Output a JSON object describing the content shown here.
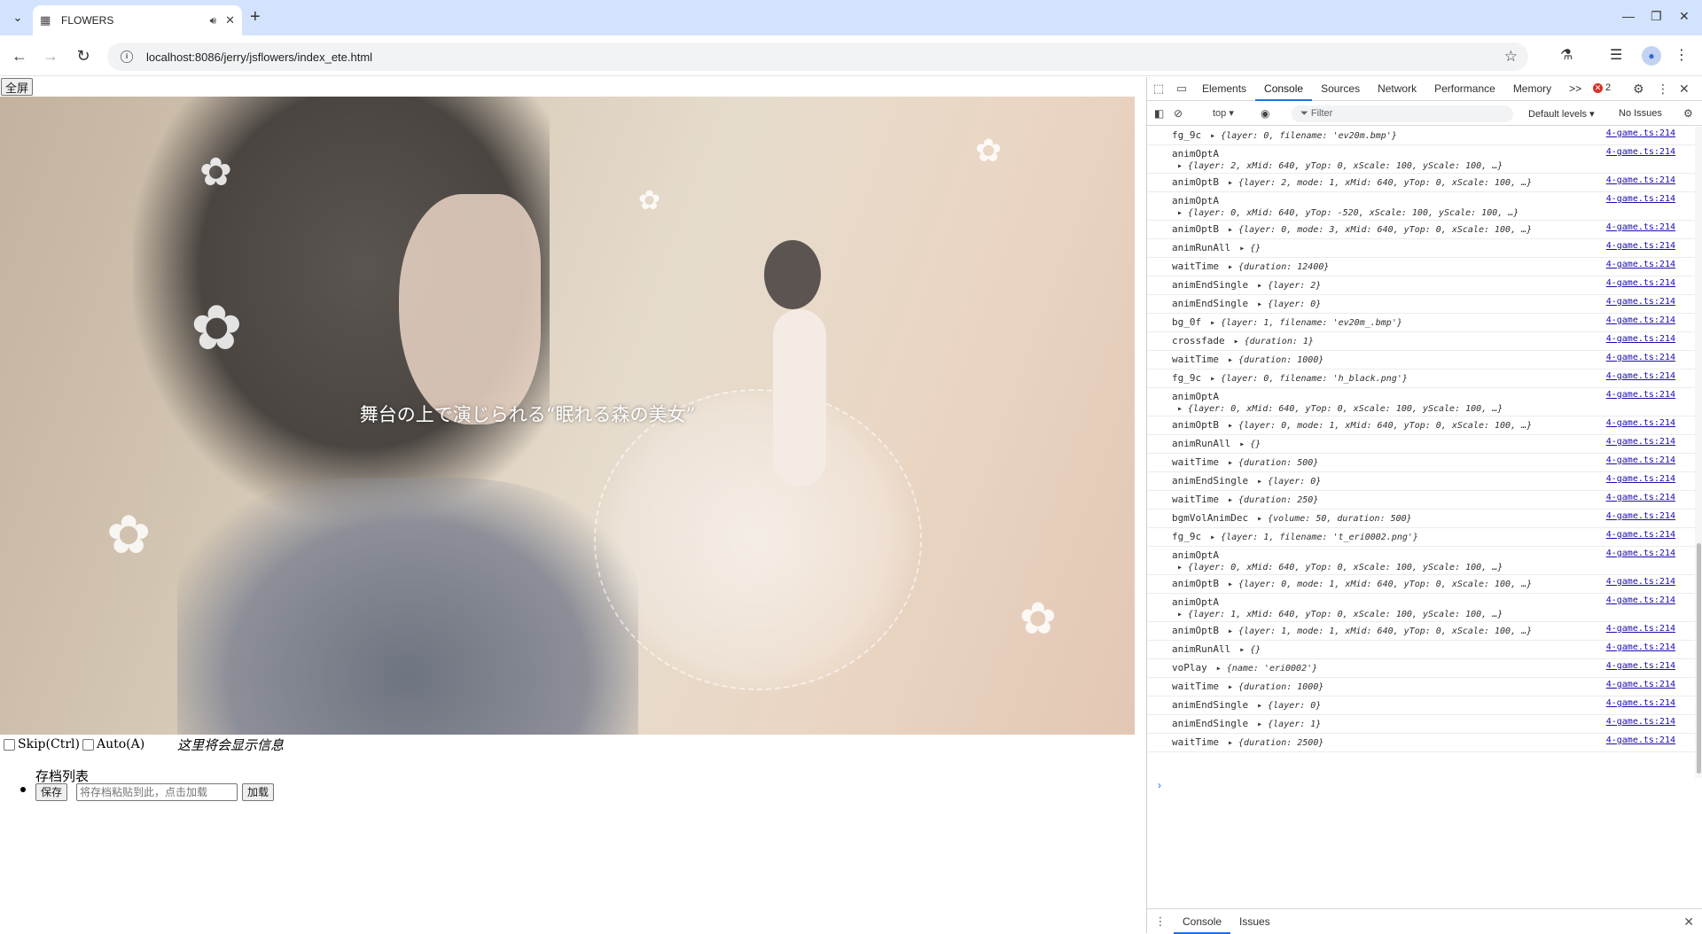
{
  "browser": {
    "tab_title": "FLOWERS",
    "url": "localhost:8086/jerry/jsflowers/index_ete.html"
  },
  "page": {
    "fullscreen_label": "全屏",
    "caption_text": "舞台の上で演じられる“眠れる森の美女”",
    "skip_label": "Skip(Ctrl)",
    "auto_label": "Auto(A)",
    "info_message": "这里将会显示信息",
    "saves_title": "存档列表",
    "save_button": "保存",
    "load_input_placeholder": "将存档粘贴到此，点击加载",
    "load_button": "加载"
  },
  "devtools": {
    "tabs": [
      "Elements",
      "Console",
      "Sources",
      "Network",
      "Performance",
      "Memory"
    ],
    "more_tabs": ">>",
    "error_count": "2",
    "context": "top",
    "filter_placeholder": "Filter",
    "levels": "Default levels",
    "issues": "No Issues",
    "drawer_tabs": [
      "Console",
      "Issues"
    ],
    "logs": [
      {
        "name": "fg_9c",
        "obj": "{layer: 0, filename: 'ev20m.bmp'}",
        "src": "4-game.ts:214",
        "wrap": false
      },
      {
        "name": "animOptA",
        "obj": "{layer: 2, xMid: 640, yTop: 0, xScale: 100, yScale: 100, …}",
        "src": "4-game.ts:214",
        "wrap": true
      },
      {
        "name": "animOptB",
        "obj": "{layer: 2, mode: 1, xMid: 640, yTop: 0, xScale: 100, …}",
        "src": "4-game.ts:214",
        "wrap": false
      },
      {
        "name": "animOptA",
        "obj": "{layer: 0, xMid: 640, yTop: -520, xScale: 100, yScale: 100, …}",
        "src": "4-game.ts:214",
        "wrap": true
      },
      {
        "name": "animOptB",
        "obj": "{layer: 0, mode: 3, xMid: 640, yTop: 0, xScale: 100, …}",
        "src": "4-game.ts:214",
        "wrap": false
      },
      {
        "name": "animRunAll",
        "obj": "{}",
        "src": "4-game.ts:214",
        "wrap": false
      },
      {
        "name": "waitTime",
        "obj": "{duration: 12400}",
        "src": "4-game.ts:214",
        "wrap": false
      },
      {
        "name": "animEndSingle",
        "obj": "{layer: 2}",
        "src": "4-game.ts:214",
        "wrap": false
      },
      {
        "name": "animEndSingle",
        "obj": "{layer: 0}",
        "src": "4-game.ts:214",
        "wrap": false
      },
      {
        "name": "bg_0f",
        "obj": "{layer: 1, filename: 'ev20m_.bmp'}",
        "src": "4-game.ts:214",
        "wrap": false
      },
      {
        "name": "crossfade",
        "obj": "{duration: 1}",
        "src": "4-game.ts:214",
        "wrap": false
      },
      {
        "name": "waitTime",
        "obj": "{duration: 1000}",
        "src": "4-game.ts:214",
        "wrap": false
      },
      {
        "name": "fg_9c",
        "obj": "{layer: 0, filename: 'h_black.png'}",
        "src": "4-game.ts:214",
        "wrap": false
      },
      {
        "name": "animOptA",
        "obj": "{layer: 0, xMid: 640, yTop: 0, xScale: 100, yScale: 100, …}",
        "src": "4-game.ts:214",
        "wrap": true
      },
      {
        "name": "animOptB",
        "obj": "{layer: 0, mode: 1, xMid: 640, yTop: 0, xScale: 100, …}",
        "src": "4-game.ts:214",
        "wrap": false
      },
      {
        "name": "animRunAll",
        "obj": "{}",
        "src": "4-game.ts:214",
        "wrap": false
      },
      {
        "name": "waitTime",
        "obj": "{duration: 500}",
        "src": "4-game.ts:214",
        "wrap": false
      },
      {
        "name": "animEndSingle",
        "obj": "{layer: 0}",
        "src": "4-game.ts:214",
        "wrap": false
      },
      {
        "name": "waitTime",
        "obj": "{duration: 250}",
        "src": "4-game.ts:214",
        "wrap": false
      },
      {
        "name": "bgmVolAnimDec",
        "obj": "{volume: 50, duration: 500}",
        "src": "4-game.ts:214",
        "wrap": false
      },
      {
        "name": "fg_9c",
        "obj": "{layer: 1, filename: 't_eri0002.png'}",
        "src": "4-game.ts:214",
        "wrap": false
      },
      {
        "name": "animOptA",
        "obj": "{layer: 0, xMid: 640, yTop: 0, xScale: 100, yScale: 100, …}",
        "src": "4-game.ts:214",
        "wrap": true
      },
      {
        "name": "animOptB",
        "obj": "{layer: 0, mode: 1, xMid: 640, yTop: 0, xScale: 100, …}",
        "src": "4-game.ts:214",
        "wrap": false
      },
      {
        "name": "animOptA",
        "obj": "{layer: 1, xMid: 640, yTop: 0, xScale: 100, yScale: 100, …}",
        "src": "4-game.ts:214",
        "wrap": true
      },
      {
        "name": "animOptB",
        "obj": "{layer: 1, mode: 1, xMid: 640, yTop: 0, xScale: 100, …}",
        "src": "4-game.ts:214",
        "wrap": false
      },
      {
        "name": "animRunAll",
        "obj": "{}",
        "src": "4-game.ts:214",
        "wrap": false
      },
      {
        "name": "voPlay",
        "obj": "{name: 'eri0002'}",
        "src": "4-game.ts:214",
        "wrap": false
      },
      {
        "name": "waitTime",
        "obj": "{duration: 1000}",
        "src": "4-game.ts:214",
        "wrap": false
      },
      {
        "name": "animEndSingle",
        "obj": "{layer: 0}",
        "src": "4-game.ts:214",
        "wrap": false
      },
      {
        "name": "animEndSingle",
        "obj": "{layer: 1}",
        "src": "4-game.ts:214",
        "wrap": false
      },
      {
        "name": "waitTime",
        "obj": "{duration: 2500}",
        "src": "4-game.ts:214",
        "wrap": false
      }
    ]
  }
}
